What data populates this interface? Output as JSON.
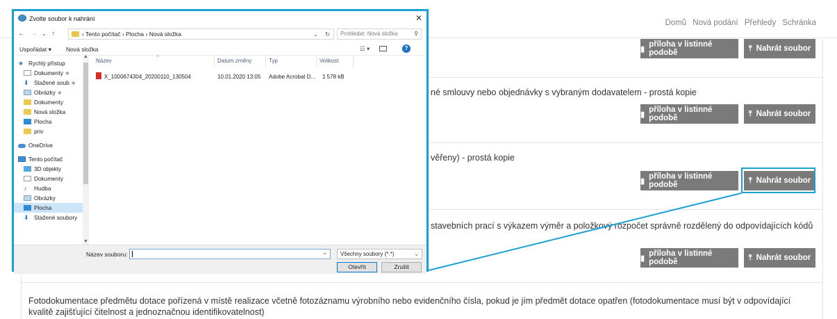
{
  "nav": {
    "links": [
      "Domů",
      "Nová podání",
      "Přehledy",
      "Schránka"
    ]
  },
  "buttons": {
    "paper": "příloha v listinné podobě",
    "upload": "Nahrát soubor"
  },
  "rows": [
    {
      "text": ""
    },
    {
      "text": "né smlouvy nebo objednávky s vybraným dodavatelem - prostá kopie"
    },
    {
      "text": "věřeny) - prostá kopie"
    },
    {
      "text": "stavebních prací s výkazem výměr a položkový rozpočet správně rozdělený do odpovídajících kódů"
    },
    {
      "text": "Fotodokumentace předmětu dotace pořízená v místě realizace včetně fotozáznamu výrobního nebo evidenčního čísla, pokud je jím předmět dotace opatřen (fotodokumentace musí být v odpovídající kvalitě zajišťující čitelnost a jednoznačnou identifikovatelnost)"
    }
  ],
  "dialog": {
    "title": "Zvolte soubor k nahrání",
    "path": "›  Tento počítač  ›  Plocha  ›  Nová složka",
    "search_placeholder": "Prohledat: Nová složka",
    "toolbar": {
      "organize": "Uspořádat ▾",
      "new_folder": "Nová složka"
    },
    "sidebar": [
      {
        "label": "Rychlý přístup",
        "icon": "star-icon"
      },
      {
        "label": "Dokumenty",
        "icon": "documents-icon",
        "pinned": true
      },
      {
        "label": "Stažené soub",
        "icon": "download-icon",
        "pinned": true
      },
      {
        "label": "Obrázky",
        "icon": "pictures-icon",
        "pinned": true
      },
      {
        "label": "Dokumenty",
        "icon": "folder-icon"
      },
      {
        "label": "Nová složka",
        "icon": "folder-icon"
      },
      {
        "label": "Plocha",
        "icon": "desktop-icon"
      },
      {
        "label": "priv",
        "icon": "folder-icon"
      },
      {
        "label": "OneDrive",
        "icon": "cloud-icon"
      },
      {
        "label": "Tento počítač",
        "icon": "computer-icon"
      },
      {
        "label": "3D objekty",
        "icon": "3d-objects-icon"
      },
      {
        "label": "Dokumenty",
        "icon": "documents-icon"
      },
      {
        "label": "Hudba",
        "icon": "music-icon"
      },
      {
        "label": "Obrázky",
        "icon": "pictures-icon"
      },
      {
        "label": "Plocha",
        "icon": "desktop-icon",
        "selected": true
      },
      {
        "label": "Stažené soubory",
        "icon": "download-icon"
      }
    ],
    "columns": {
      "name": "Název",
      "date": "Datum změny",
      "type": "Typ",
      "size": "Velikost"
    },
    "files": [
      {
        "name": "X_1000674304_20200110_130504",
        "date": "10.01.2020 13:05",
        "type": "Adobe Acrobat D...",
        "size": "1 578 kB"
      }
    ],
    "filename_label": "Název souboru:",
    "filename_value": "",
    "filter": "Všechny soubory (*.*)",
    "open": "Otevřít",
    "cancel": "Zrušit"
  },
  "colors": {
    "accent": "#1a9fd6",
    "button_gray": "#7a7a7a"
  }
}
